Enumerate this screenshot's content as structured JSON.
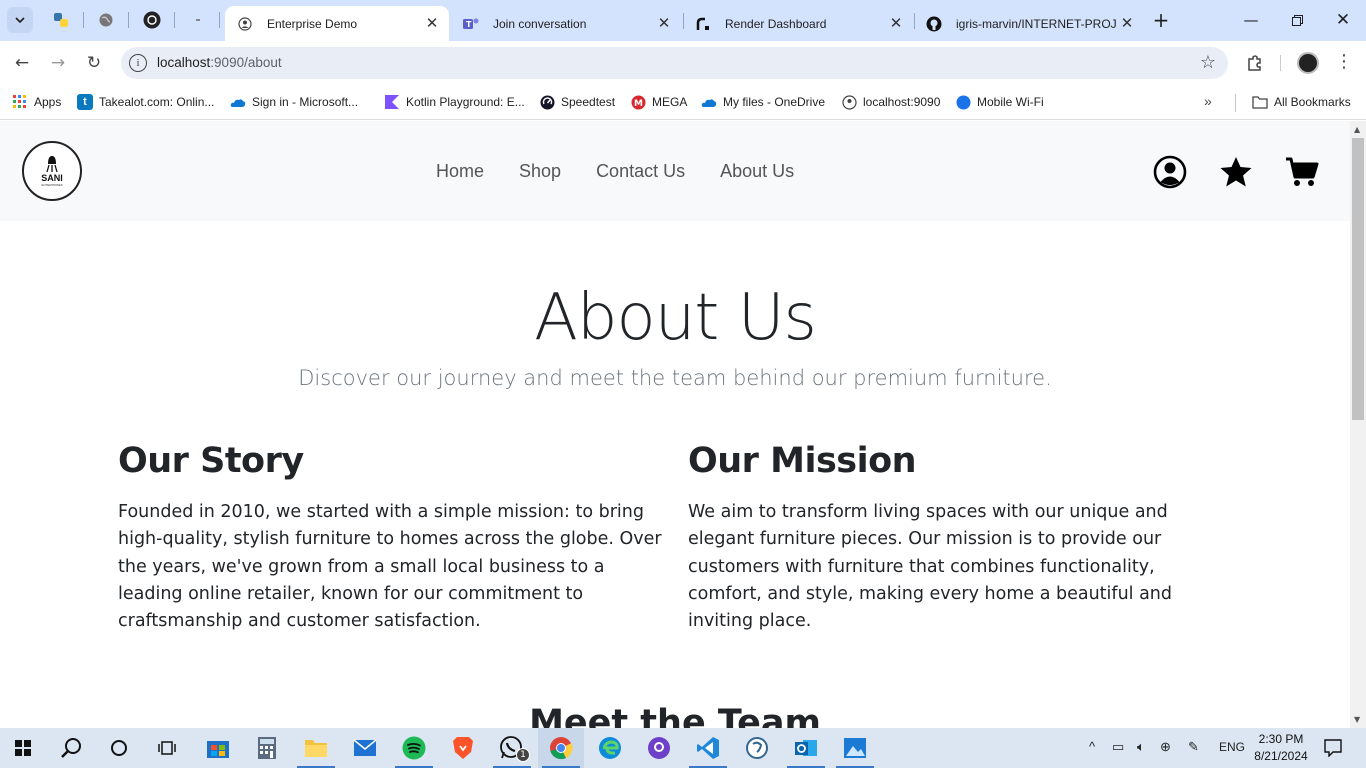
{
  "browser": {
    "tabs": [
      {
        "title": "Enterprise Demo",
        "icon": "page-icon",
        "active": true
      },
      {
        "title": "Join conversation",
        "icon": "teams-icon",
        "active": false
      },
      {
        "title": "Render Dashboard",
        "icon": "render-icon",
        "active": false
      },
      {
        "title": "igris-marvin/INTERNET-PROJE",
        "icon": "github-icon",
        "active": false
      }
    ],
    "url_host": "localhost",
    "url_path": ":9090/about",
    "bookmarks": [
      {
        "label": "Apps",
        "icon": "apps-grid-icon"
      },
      {
        "label": "Takealot.com: Onlin...",
        "icon": "takealot-icon"
      },
      {
        "label": "Sign in - Microsoft...",
        "icon": "onedrive-cloud-icon"
      },
      {
        "label": "Kotlin Playground: E...",
        "icon": "kotlin-icon"
      },
      {
        "label": "Speedtest",
        "icon": "speedtest-icon"
      },
      {
        "label": "MEGA",
        "icon": "mega-icon"
      },
      {
        "label": "My files - OneDrive",
        "icon": "onedrive-cloud-icon"
      },
      {
        "label": "localhost:9090",
        "icon": "localhost-icon"
      },
      {
        "label": "Mobile Wi-Fi",
        "icon": "wifi-dot-icon"
      }
    ],
    "all_bookmarks": "All Bookmarks"
  },
  "site": {
    "logo_text": "SANI",
    "logo_subtext": "ENTERPRISES",
    "nav": [
      "Home",
      "Shop",
      "Contact Us",
      "About Us"
    ],
    "header_icons": [
      "account-icon",
      "favorites-star-icon",
      "cart-icon"
    ]
  },
  "page": {
    "title": "About Us",
    "subtitle": "Discover our journey and meet the team behind our premium furniture.",
    "story_heading": "Our Story",
    "story_text": "Founded in 2010, we started with a simple mission: to bring high-quality, stylish furniture to homes across the globe. Over the years, we've grown from a small local business to a leading online retailer, known for our commitment to craftsmanship and customer satisfaction.",
    "mission_heading": "Our Mission",
    "mission_text": "We aim to transform living spaces with our unique and elegant furniture pieces. Our mission is to provide our customers with furniture that combines functionality, comfort, and style, making every home a beautiful and inviting place.",
    "team_heading": "Meet the Team"
  },
  "taskbar": {
    "language": "ENG",
    "time": "2:30 PM",
    "date": "8/21/2024",
    "whatsapp_badge": "1"
  },
  "colors": {
    "tabstrip": "#d3e3fd",
    "omnibox": "#e9eef6",
    "site_nav_bg": "#f8f9fa",
    "heading": "#212529",
    "muted": "#6c757d",
    "taskbar": "#dce6f2"
  }
}
